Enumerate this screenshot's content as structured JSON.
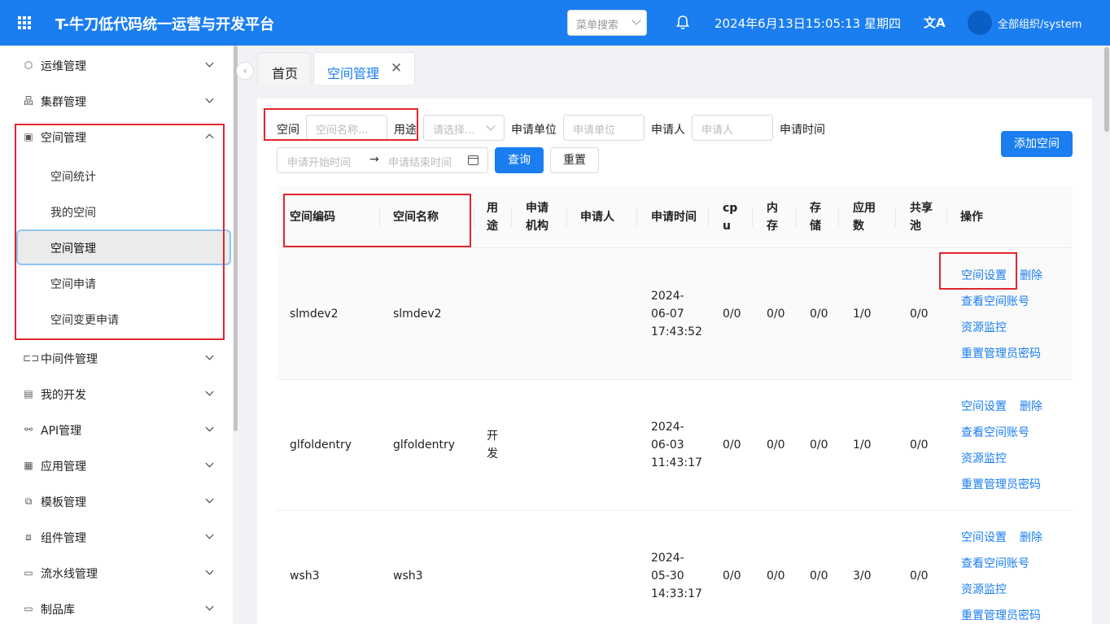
{
  "header": {
    "title": "T-牛刀低代码统一运营与开发平台",
    "menu_search_placeholder": "菜单搜索",
    "datetime": "2024年6月13日15:05:13 星期四",
    "translate_glyph": "文A",
    "org": "全部组织/system",
    "brand_color": "#1a7ef0"
  },
  "sidebar": {
    "items": [
      {
        "label": "运维管理",
        "icon": "ops-icon"
      },
      {
        "label": "集群管理",
        "icon": "cluster-icon"
      },
      {
        "label": "空间管理",
        "icon": "space-icon",
        "expanded": true
      },
      {
        "label": "中间件管理",
        "icon": "middleware-icon"
      },
      {
        "label": "我的开发",
        "icon": "dev-icon"
      },
      {
        "label": "API管理",
        "icon": "api-icon"
      },
      {
        "label": "应用管理",
        "icon": "app-icon"
      },
      {
        "label": "模板管理",
        "icon": "template-icon"
      },
      {
        "label": "组件管理",
        "icon": "component-icon"
      },
      {
        "label": "流水线管理",
        "icon": "pipeline-icon"
      },
      {
        "label": "制品库",
        "icon": "folder-icon"
      }
    ],
    "sub_items": [
      "空间统计",
      "我的空间",
      "空间管理",
      "空间申请",
      "空间变更申请"
    ],
    "active_sub": "空间管理"
  },
  "tabs": [
    {
      "label": "首页"
    },
    {
      "label": "空间管理",
      "active": true
    }
  ],
  "filters": {
    "space_label": "空间",
    "space_placeholder": "空间名称...",
    "usage_label": "用途",
    "usage_placeholder": "请选择...",
    "unit_label": "申请单位",
    "unit_placeholder": "申请单位",
    "applicant_label": "申请人",
    "applicant_placeholder": "申请人",
    "time_label": "申请时间",
    "start_placeholder": "申请开始时间",
    "end_placeholder": "申请结束时间",
    "range_arrow": "→",
    "query_button": "查询",
    "reset_button": "重置",
    "add_button": "添加空间"
  },
  "table": {
    "columns": [
      "空间编码",
      "空间名称",
      "用途",
      "申请机构",
      "申请人",
      "申请时间",
      "cpu",
      "内存",
      "存储",
      "应用数",
      "共享池",
      "操作"
    ],
    "columns_display": [
      "空间编码",
      "空间名称",
      "用\n途",
      "申请\n机构",
      "申请人",
      "申请时间",
      "cp\nu",
      "内\n存",
      "存\n储",
      "应用\n数",
      "共享\n池",
      "操作"
    ],
    "actions": [
      "空间设置",
      "删除",
      "查看空间账号",
      "资源监控",
      "重置管理员密码"
    ],
    "rows": [
      {
        "code": "slmdev2",
        "name": "slmdev2",
        "usage": "",
        "org": "",
        "applicant": "",
        "time": "2024-\n06-07\n17:43:52",
        "cpu": "0/0",
        "mem": "0/0",
        "storage": "0/0",
        "apps": "1/0",
        "pool": "0/0"
      },
      {
        "code": "glfoldentry",
        "name": "glfoldentry",
        "usage": "开\n发",
        "org": "",
        "applicant": "",
        "time": "2024-\n06-03\n11:43:17",
        "cpu": "0/0",
        "mem": "0/0",
        "storage": "0/0",
        "apps": "1/0",
        "pool": "0/0"
      },
      {
        "code": "wsh3",
        "name": "wsh3",
        "usage": "",
        "org": "",
        "applicant": "",
        "time": "2024-\n05-30\n14:33:17",
        "cpu": "0/0",
        "mem": "0/0",
        "storage": "0/0",
        "apps": "3/0",
        "pool": "0/0"
      }
    ]
  }
}
